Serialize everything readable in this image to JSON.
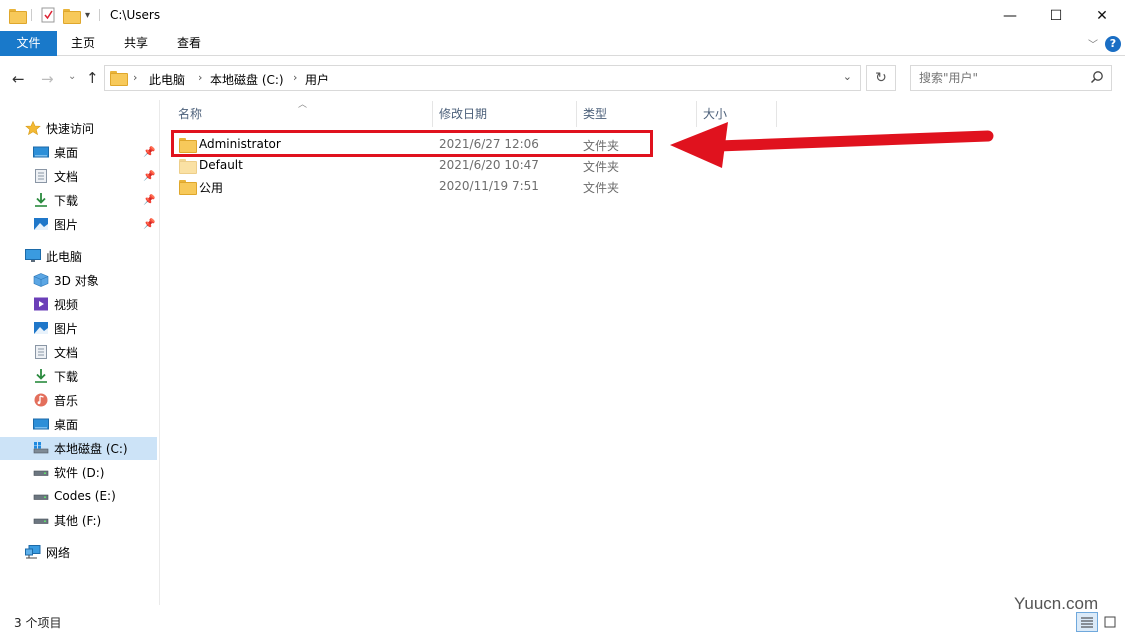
{
  "window": {
    "title": "C:\\Users",
    "minimize_glyph": "—",
    "maximize_glyph": "☐",
    "close_glyph": "✕"
  },
  "ribbon": {
    "tabs": [
      "文件",
      "主页",
      "共享",
      "查看"
    ],
    "help_glyph": "?"
  },
  "address": {
    "breadcrumbs": [
      "此电脑",
      "本地磁盘 (C:)",
      "用户"
    ],
    "search_placeholder": "搜索\"用户\""
  },
  "sidebar": {
    "quick_access": {
      "label": "快速访问",
      "items": [
        {
          "label": "桌面",
          "icon": "desktop-icon",
          "pinned": true
        },
        {
          "label": "文档",
          "icon": "documents-icon",
          "pinned": true
        },
        {
          "label": "下载",
          "icon": "downloads-icon",
          "pinned": true
        },
        {
          "label": "图片",
          "icon": "pictures-icon",
          "pinned": true
        }
      ]
    },
    "this_pc": {
      "label": "此电脑",
      "items": [
        {
          "label": "3D 对象",
          "icon": "3d-objects-icon"
        },
        {
          "label": "视频",
          "icon": "videos-icon"
        },
        {
          "label": "图片",
          "icon": "pictures-icon"
        },
        {
          "label": "文档",
          "icon": "documents-icon"
        },
        {
          "label": "下载",
          "icon": "downloads-icon"
        },
        {
          "label": "音乐",
          "icon": "music-icon"
        },
        {
          "label": "桌面",
          "icon": "desktop-icon"
        },
        {
          "label": "本地磁盘 (C:)",
          "icon": "system-drive-icon",
          "selected": true
        },
        {
          "label": "软件 (D:)",
          "icon": "drive-icon"
        },
        {
          "label": "Codes (E:)",
          "icon": "drive-icon"
        },
        {
          "label": "其他 (F:)",
          "icon": "drive-icon"
        }
      ]
    },
    "network": {
      "label": "网络",
      "icon": "network-icon"
    }
  },
  "filelist": {
    "columns": [
      "名称",
      "修改日期",
      "类型",
      "大小"
    ],
    "rows": [
      {
        "name": "Administrator",
        "date": "2021/6/27 12:06",
        "type": "文件夹",
        "highlighted": true
      },
      {
        "name": "Default",
        "date": "2021/6/20 10:47",
        "type": "文件夹"
      },
      {
        "name": "公用",
        "date": "2020/11/19 7:51",
        "type": "文件夹"
      }
    ]
  },
  "annotation": {
    "color": "#e0121e"
  },
  "status": {
    "item_count": "3 个项目"
  },
  "watermark": "Yuucn.com"
}
